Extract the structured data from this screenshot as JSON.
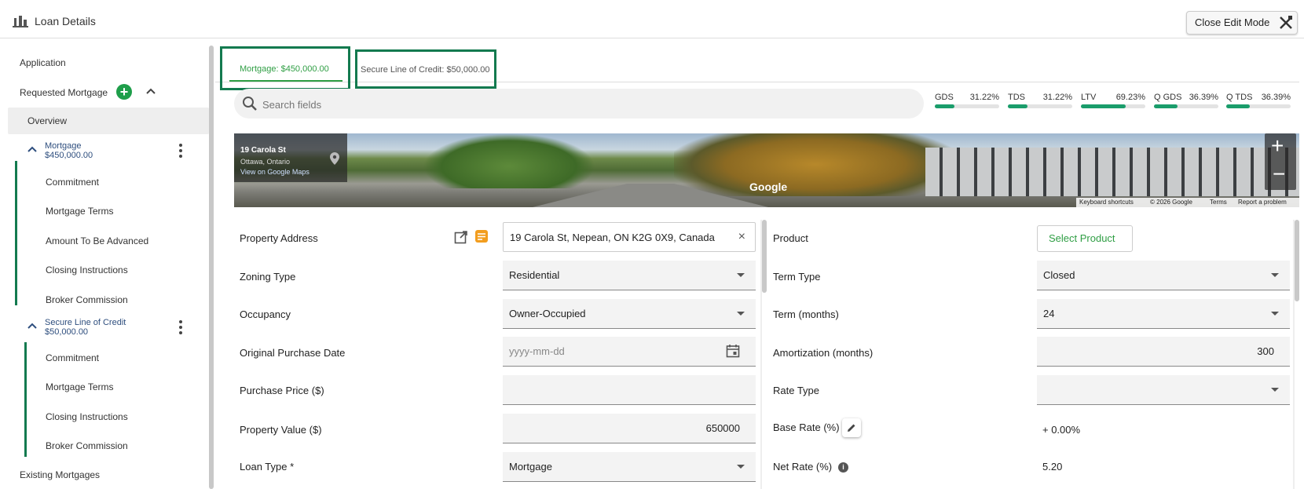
{
  "header": {
    "title": "Loan Details",
    "close_label": "Close Edit Mode"
  },
  "sidebar": {
    "application": "Application",
    "requested_mortgage": "Requested Mortgage",
    "overview": "Overview",
    "groups": [
      {
        "title": "Mortgage",
        "amount": "$450,000.00",
        "items": [
          "Commitment",
          "Mortgage Terms",
          "Amount To Be Advanced",
          "Closing Instructions",
          "Broker Commission"
        ]
      },
      {
        "title": "Secure Line of Credit",
        "amount": "$50,000.00",
        "items": [
          "Commitment",
          "Mortgage Terms",
          "Closing Instructions",
          "Broker Commission"
        ]
      }
    ],
    "existing_mortgages": "Existing Mortgages"
  },
  "tabs": [
    {
      "label": "Mortgage: $450,000.00",
      "active": true
    },
    {
      "label": "Secure Line of Credit: $50,000.00",
      "active": false
    }
  ],
  "search": {
    "placeholder": "Search fields"
  },
  "ratios": [
    {
      "name": "GDS",
      "value": "31.22%",
      "level": 0.31
    },
    {
      "name": "TDS",
      "value": "31.22%",
      "level": 0.31
    },
    {
      "name": "LTV",
      "value": "69.23%",
      "level": 0.69
    },
    {
      "name": "Q GDS",
      "value": "36.39%",
      "level": 0.36
    },
    {
      "name": "Q TDS",
      "value": "36.39%",
      "level": 0.36
    }
  ],
  "streetview": {
    "address_line1": "19 Carola St",
    "address_line2": "Ottawa, Ontario",
    "link": "View on Google Maps",
    "logo": "Google",
    "attribution": [
      "Keyboard shortcuts",
      "© 2026 Google",
      "Terms",
      "Report a problem"
    ]
  },
  "left_form": {
    "property_address": {
      "label": "Property Address",
      "value": "19 Carola St, Nepean, ON K2G 0X9, Canada"
    },
    "zoning_type": {
      "label": "Zoning Type",
      "value": "Residential"
    },
    "occupancy": {
      "label": "Occupancy",
      "value": "Owner-Occupied"
    },
    "original_purchase_date": {
      "label": "Original Purchase Date",
      "placeholder": "yyyy-mm-dd"
    },
    "purchase_price": {
      "label": "Purchase Price ($)",
      "value": ""
    },
    "property_value": {
      "label": "Property Value ($)",
      "value": "650000"
    },
    "loan_type": {
      "label": "Loan Type *",
      "value": "Mortgage"
    }
  },
  "right_form": {
    "product": {
      "label": "Product",
      "button": "Select Product"
    },
    "term_type": {
      "label": "Term Type",
      "value": "Closed"
    },
    "term_months": {
      "label": "Term (months)",
      "value": "24"
    },
    "amortization": {
      "label": "Amortization (months)",
      "value": "300"
    },
    "rate_type": {
      "label": "Rate Type",
      "value": ""
    },
    "base_rate": {
      "label": "Base Rate (%)",
      "value": "+ 0.00%"
    },
    "net_rate": {
      "label": "Net Rate (%)",
      "value": "5.20"
    }
  },
  "colors": {
    "accent_green": "#2f9e44",
    "border_green": "#137a4f",
    "ratio_fill": "#1a9d6b",
    "link_blue": "#2e4e7e"
  }
}
